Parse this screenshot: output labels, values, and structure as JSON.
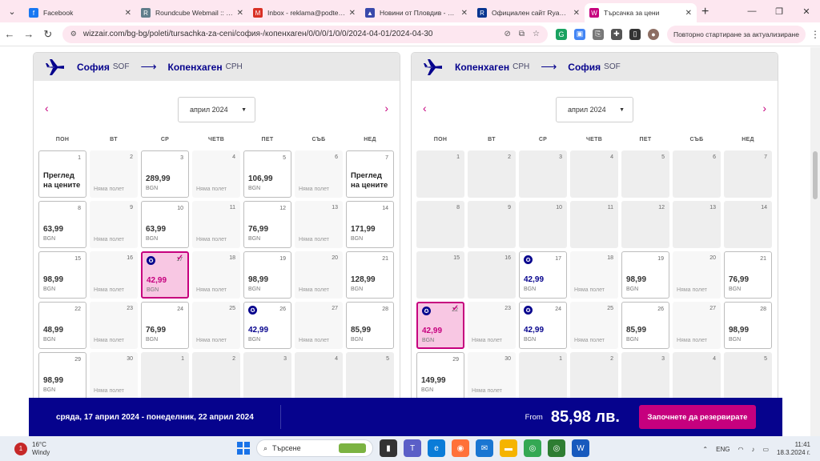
{
  "browser": {
    "tabs": [
      {
        "title": "Facebook",
        "color": "#1877f2",
        "glyph": "f"
      },
      {
        "title": "Roundcube Webmail :: Inb",
        "color": "#607d8b",
        "glyph": "R"
      },
      {
        "title": "Inbox - reklama@podtepe",
        "color": "#d93025",
        "glyph": "M"
      },
      {
        "title": "Новини от Пловдив - Акт",
        "color": "#3949ab",
        "glyph": "▲"
      },
      {
        "title": "Официален сайт Ryanair",
        "color": "#073590",
        "glyph": "R"
      },
      {
        "title": "Търсачка за цени",
        "color": "#c6007e",
        "glyph": "W"
      }
    ],
    "url": "wizzair.com/bg-bg/poleti/tursachka-za-ceni/софия-/копенхаген/0/0/0/1/0/0/2024-04-01/2024-04-30",
    "restart_label": "Повторно стартиране за актуализиране"
  },
  "panels": [
    {
      "from_city": "София",
      "from_code": "SOF",
      "to_city": "Копенхаген",
      "to_code": "CPH",
      "month_label": "април 2024",
      "weekdays": [
        "ПОН",
        "ВТ",
        "СР",
        "ЧЕТВ",
        "ПЕТ",
        "СЪБ",
        "НЕД"
      ],
      "days": [
        {
          "d": "1",
          "type": "text",
          "text": "Преглед на цените"
        },
        {
          "d": "2",
          "type": "none",
          "text": "Няма полет"
        },
        {
          "d": "3",
          "type": "price",
          "price": "289,99",
          "cur": "BGN"
        },
        {
          "d": "4",
          "type": "none",
          "text": "Няма полет"
        },
        {
          "d": "5",
          "type": "price",
          "price": "106,99",
          "cur": "BGN"
        },
        {
          "d": "6",
          "type": "none",
          "text": "Няма полет"
        },
        {
          "d": "7",
          "type": "text",
          "text": "Преглед на цените"
        },
        {
          "d": "8",
          "type": "price",
          "price": "63,99",
          "cur": "BGN"
        },
        {
          "d": "9",
          "type": "none",
          "text": "Няма полет"
        },
        {
          "d": "10",
          "type": "price",
          "price": "63,99",
          "cur": "BGN"
        },
        {
          "d": "11",
          "type": "none",
          "text": "Няма полет"
        },
        {
          "d": "12",
          "type": "price",
          "price": "76,99",
          "cur": "BGN"
        },
        {
          "d": "13",
          "type": "none",
          "text": "Няма полет"
        },
        {
          "d": "14",
          "type": "price",
          "price": "171,99",
          "cur": "BGN"
        },
        {
          "d": "15",
          "type": "price",
          "price": "98,99",
          "cur": "BGN"
        },
        {
          "d": "16",
          "type": "none",
          "text": "Няма полет"
        },
        {
          "d": "17",
          "type": "price",
          "price": "42,99",
          "cur": "BGN",
          "discount": true,
          "selected": true
        },
        {
          "d": "18",
          "type": "none",
          "text": "Няма полет"
        },
        {
          "d": "19",
          "type": "price",
          "price": "98,99",
          "cur": "BGN"
        },
        {
          "d": "20",
          "type": "none",
          "text": "Няма полет"
        },
        {
          "d": "21",
          "type": "price",
          "price": "128,99",
          "cur": "BGN"
        },
        {
          "d": "22",
          "type": "price",
          "price": "48,99",
          "cur": "BGN"
        },
        {
          "d": "23",
          "type": "none",
          "text": "Няма полет"
        },
        {
          "d": "24",
          "type": "price",
          "price": "76,99",
          "cur": "BGN"
        },
        {
          "d": "25",
          "type": "none",
          "text": "Няма полет"
        },
        {
          "d": "26",
          "type": "price",
          "price": "42,99",
          "cur": "BGN",
          "discount": true
        },
        {
          "d": "27",
          "type": "none",
          "text": "Няма полет"
        },
        {
          "d": "28",
          "type": "price",
          "price": "85,99",
          "cur": "BGN"
        },
        {
          "d": "29",
          "type": "price",
          "price": "98,99",
          "cur": "BGN"
        },
        {
          "d": "30",
          "type": "none",
          "text": "Няма полет"
        },
        {
          "d": "1",
          "type": "past"
        },
        {
          "d": "2",
          "type": "past"
        },
        {
          "d": "3",
          "type": "past"
        },
        {
          "d": "4",
          "type": "past"
        },
        {
          "d": "5",
          "type": "past"
        }
      ]
    },
    {
      "from_city": "Копенхаген",
      "from_code": "CPH",
      "to_city": "София",
      "to_code": "SOF",
      "month_label": "април 2024",
      "weekdays": [
        "ПОН",
        "ВТ",
        "СР",
        "ЧЕТВ",
        "ПЕТ",
        "СЪБ",
        "НЕД"
      ],
      "days": [
        {
          "d": "1",
          "type": "past"
        },
        {
          "d": "2",
          "type": "past"
        },
        {
          "d": "3",
          "type": "past"
        },
        {
          "d": "4",
          "type": "past"
        },
        {
          "d": "5",
          "type": "past"
        },
        {
          "d": "6",
          "type": "past"
        },
        {
          "d": "7",
          "type": "past"
        },
        {
          "d": "8",
          "type": "past"
        },
        {
          "d": "9",
          "type": "past"
        },
        {
          "d": "10",
          "type": "past"
        },
        {
          "d": "11",
          "type": "past"
        },
        {
          "d": "12",
          "type": "past"
        },
        {
          "d": "13",
          "type": "past"
        },
        {
          "d": "14",
          "type": "past"
        },
        {
          "d": "15",
          "type": "past"
        },
        {
          "d": "16",
          "type": "past"
        },
        {
          "d": "17",
          "type": "price",
          "price": "42,99",
          "cur": "BGN",
          "discount": true
        },
        {
          "d": "18",
          "type": "none",
          "text": "Няма полет"
        },
        {
          "d": "19",
          "type": "price",
          "price": "98,99",
          "cur": "BGN"
        },
        {
          "d": "20",
          "type": "none",
          "text": "Няма полет"
        },
        {
          "d": "21",
          "type": "price",
          "price": "76,99",
          "cur": "BGN"
        },
        {
          "d": "22",
          "type": "price",
          "price": "42,99",
          "cur": "BGN",
          "discount": true,
          "selected": true
        },
        {
          "d": "23",
          "type": "none",
          "text": "Няма полет"
        },
        {
          "d": "24",
          "type": "price",
          "price": "42,99",
          "cur": "BGN",
          "discount": true
        },
        {
          "d": "25",
          "type": "none",
          "text": "Няма полет"
        },
        {
          "d": "26",
          "type": "price",
          "price": "85,99",
          "cur": "BGN"
        },
        {
          "d": "27",
          "type": "none",
          "text": "Няма полет"
        },
        {
          "d": "28",
          "type": "price",
          "price": "98,99",
          "cur": "BGN"
        },
        {
          "d": "29",
          "type": "price",
          "price": "149,99",
          "cur": "BGN"
        },
        {
          "d": "30",
          "type": "none",
          "text": "Няма полет"
        },
        {
          "d": "1",
          "type": "past"
        },
        {
          "d": "2",
          "type": "past"
        },
        {
          "d": "3",
          "type": "past"
        },
        {
          "d": "4",
          "type": "past"
        },
        {
          "d": "5",
          "type": "past"
        }
      ]
    }
  ],
  "booking": {
    "dates": "сряда, 17 април 2024 - понеделник, 22 април 2024",
    "from_label": "From",
    "total": "85,98 лв.",
    "book_label": "Започнете да резервирате"
  },
  "taskbar": {
    "temp": "16°C",
    "weather": "Windy",
    "search_placeholder": "Търсене",
    "lang": "ENG",
    "time": "11:41",
    "date": "18.3.2024 г."
  },
  "colors": {
    "brand_navy": "#06038d",
    "brand_magenta": "#c6007e",
    "selected_bg": "#f8c7e3"
  }
}
